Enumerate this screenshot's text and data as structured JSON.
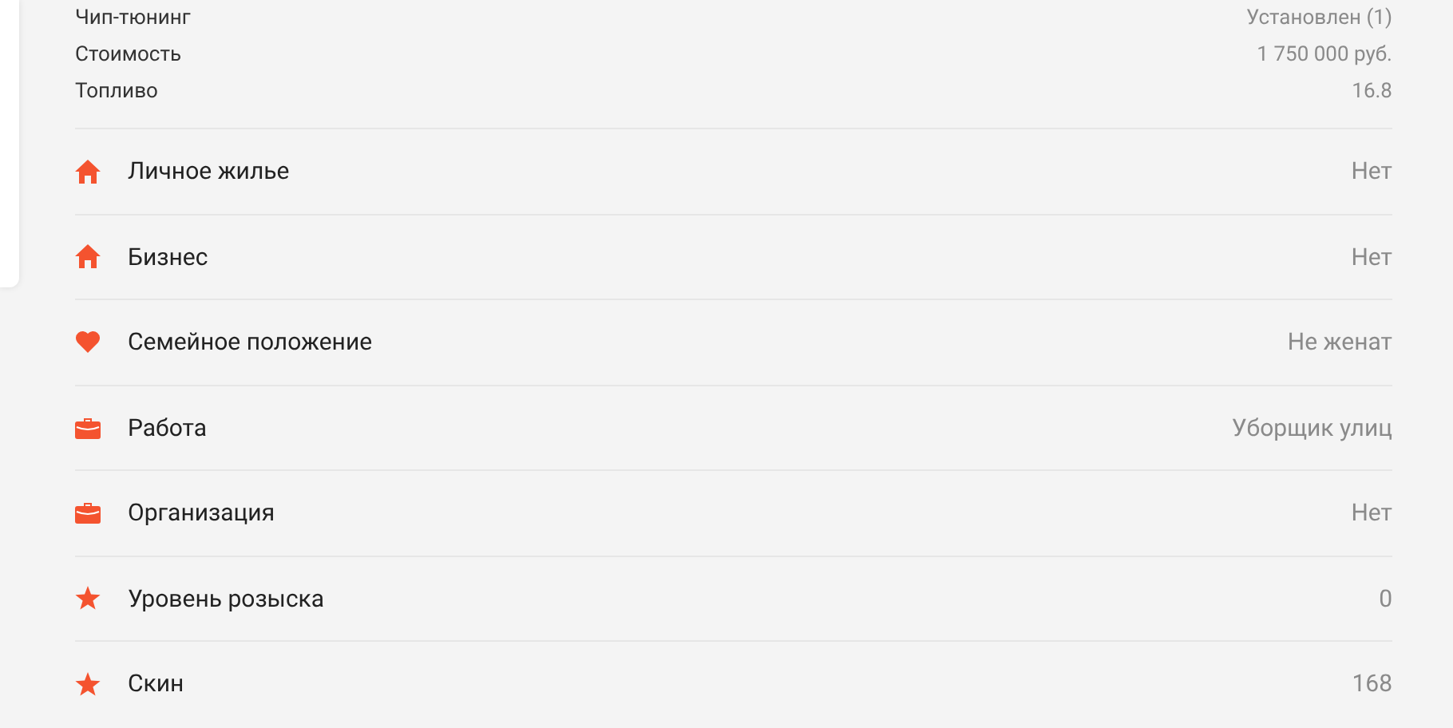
{
  "details": [
    {
      "label": "Чип-тюнинг",
      "value": "Установлен (1)"
    },
    {
      "label": "Стоимость",
      "value": "1 750 000 руб."
    },
    {
      "label": "Топливо",
      "value": "16.8"
    }
  ],
  "properties": [
    {
      "kind": "house",
      "label": "Личное жилье",
      "value": "Нет"
    },
    {
      "kind": "house",
      "label": "Бизнес",
      "value": "Нет"
    },
    {
      "kind": "heart",
      "label": "Семейное положение",
      "value": "Не женат"
    },
    {
      "kind": "briefcase",
      "label": "Работа",
      "value": "Уборщик улиц"
    },
    {
      "kind": "briefcase",
      "label": "Организация",
      "value": "Нет"
    },
    {
      "kind": "star",
      "label": "Уровень розыска",
      "value": "0"
    },
    {
      "kind": "star",
      "label": "Скин",
      "value": "168"
    }
  ]
}
